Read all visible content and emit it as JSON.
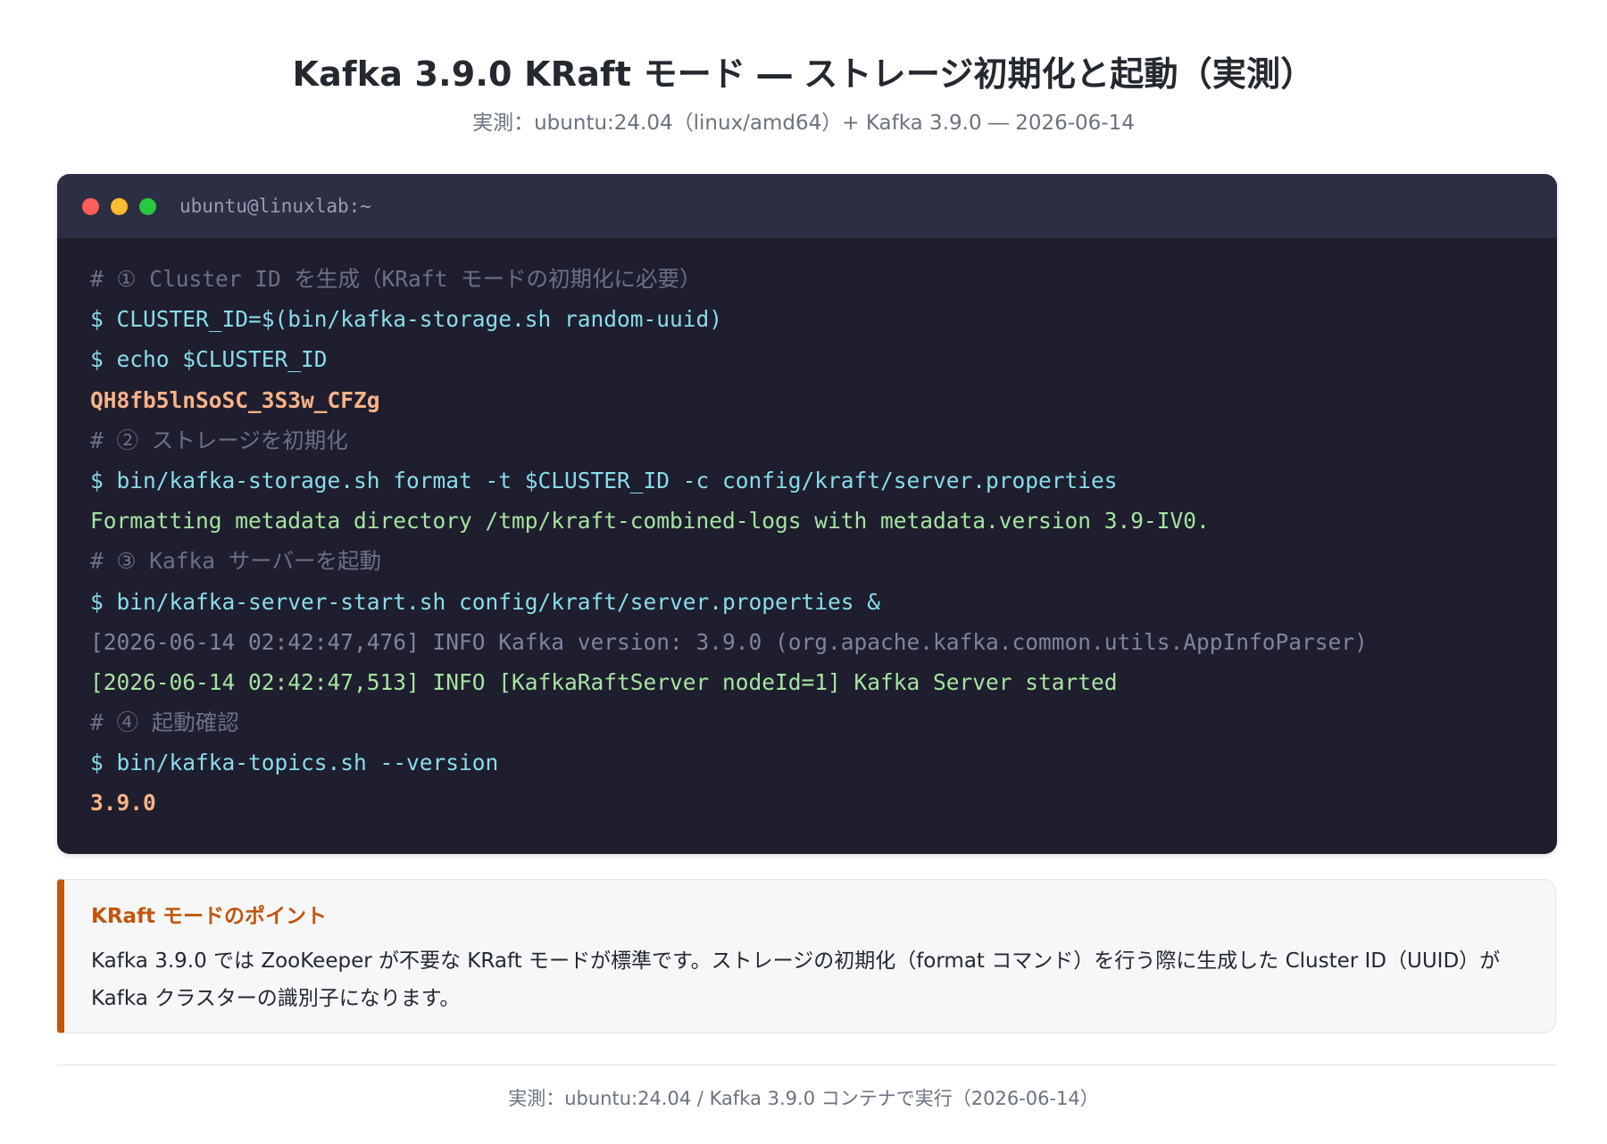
{
  "header": {
    "title": "Kafka 3.9.0 KRaft モード ― ストレージ初期化と起動（実測）",
    "subtitle": "実測：ubuntu:24.04（linux/amd64）+ Kafka 3.9.0 ― 2026-06-14"
  },
  "terminal": {
    "window_title": "ubuntu@linuxlab:~",
    "lines": [
      {
        "kind": "comment",
        "text": "# ① Cluster ID を生成（KRaft モードの初期化に必要）"
      },
      {
        "kind": "command",
        "text": "$ CLUSTER_ID=$(bin/kafka-storage.sh random-uuid)"
      },
      {
        "kind": "command",
        "text": "$ echo $CLUSTER_ID"
      },
      {
        "kind": "output",
        "text": "QH8fb5lnSoSC_3S3w_CFZg"
      },
      {
        "kind": "comment",
        "text": "# ② ストレージを初期化"
      },
      {
        "kind": "command",
        "text": "$ bin/kafka-storage.sh format -t $CLUSTER_ID -c config/kraft/server.properties"
      },
      {
        "kind": "success",
        "text": "Formatting metadata directory /tmp/kraft-combined-logs with metadata.version 3.9-IV0."
      },
      {
        "kind": "comment",
        "text": "# ③ Kafka サーバーを起動"
      },
      {
        "kind": "command",
        "text": "$ bin/kafka-server-start.sh config/kraft/server.properties &"
      },
      {
        "kind": "log",
        "text": "[2026-06-14 02:42:47,476] INFO Kafka version: 3.9.0 (org.apache.kafka.common.utils.AppInfoParser)"
      },
      {
        "kind": "success",
        "text": "[2026-06-14 02:42:47,513] INFO [KafkaRaftServer nodeId=1] Kafka Server started"
      },
      {
        "kind": "comment",
        "text": "# ④ 起動確認"
      },
      {
        "kind": "command",
        "text": "$ bin/kafka-topics.sh --version"
      },
      {
        "kind": "output",
        "text": "3.9.0"
      }
    ]
  },
  "note": {
    "title": "KRaft モードのポイント",
    "body": "Kafka 3.9.0 では ZooKeeper が不要な KRaft モードが標準です。ストレージの初期化（format コマンド）を行う際に生成した Cluster ID（UUID）が Kafka クラスターの識別子になります。"
  },
  "footer": {
    "text": "実測：ubuntu:24.04 / Kafka 3.9.0 コンテナで実行（2026-06-14）"
  },
  "colors": {
    "terminal_bg": "#1e1e2e",
    "terminal_header": "#2c2e44",
    "comment": "#6c7086",
    "command": "#89dceb",
    "output": "#fab387",
    "success": "#a6e3a1",
    "log": "#7f849c",
    "note_accent": "#c2560c"
  }
}
